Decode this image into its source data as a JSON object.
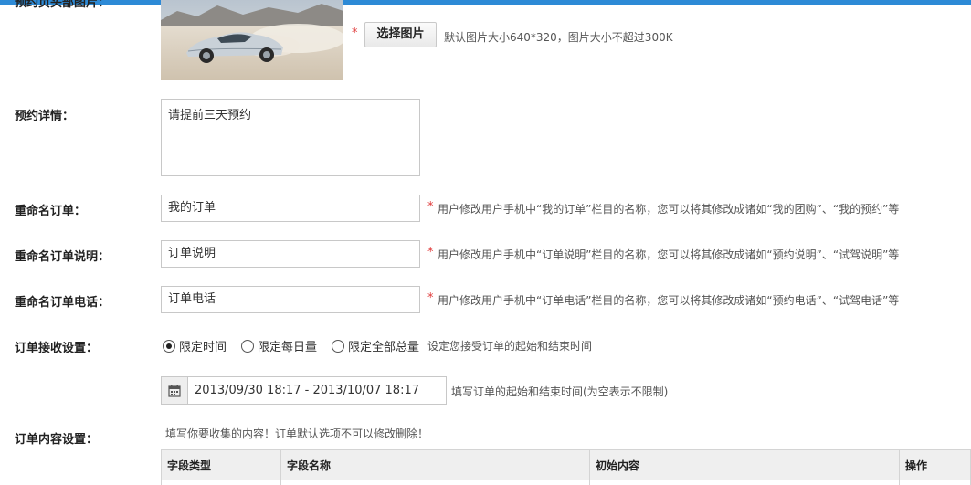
{
  "image_section": {
    "label": "预约页头部图片：",
    "required_mark": "*",
    "upload_button": "选择图片",
    "hint": "默认图片大小640*320，图片大小不超过300K"
  },
  "details": {
    "label": "预约详情：",
    "value": "请提前三天预约"
  },
  "rename_order": {
    "label": "重命名订单：",
    "value": "我的订单",
    "required_mark": "*",
    "hint": "用户修改用户手机中“我的订单”栏目的名称，您可以将其修改成诸如“我的团购”、“我的预约”等"
  },
  "rename_order_desc": {
    "label": "重命名订单说明：",
    "value": "订单说明",
    "required_mark": "*",
    "hint": "用户修改用户手机中“订单说明”栏目的名称，您可以将其修改成诸如“预约说明”、“试驾说明”等"
  },
  "rename_order_phone": {
    "label": "重命名订单电话：",
    "value": "订单电话",
    "required_mark": "*",
    "hint": "用户修改用户手机中“订单电话”栏目的名称，您可以将其修改成诸如“预约电话”、“试驾电话”等"
  },
  "order_receive": {
    "label": "订单接收设置：",
    "options": [
      "限定时间",
      "限定每日量",
      "限定全部总量"
    ],
    "selected": "限定时间",
    "hint": "设定您接受订单的起始和结束时间",
    "date_range": "2013/09/30 18:17 - 2013/10/07 18:17",
    "date_hint": "填写订单的起始和结束时间(为空表示不限制)"
  },
  "order_content": {
    "label": "订单内容设置：",
    "hint": "填写你要收集的内容！订单默认选项不可以修改删除！",
    "columns": [
      "字段类型",
      "字段名称",
      "初始内容",
      "操作"
    ]
  },
  "icons": {
    "calendar": "calendar-icon",
    "radio": "radio-button-icon",
    "thumbnail": "car-photo-thumbnail"
  },
  "colors": {
    "top_bar": "#2d8ad6",
    "required": "#e03b3b",
    "table_header_bg": "#efefef"
  }
}
